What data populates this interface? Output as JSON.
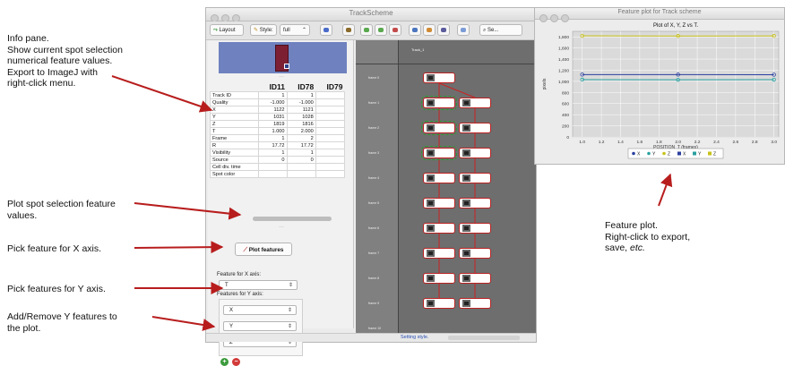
{
  "annotations": {
    "info": [
      "Info pane.",
      "Show current spot selection",
      "numerical feature values.",
      "Export to ImageJ with",
      "right-click menu."
    ],
    "plot": [
      "Plot spot selection feature",
      "values."
    ],
    "xaxis": [
      "Pick feature for X axis."
    ],
    "yaxis": [
      "Pick features for Y axis."
    ],
    "addremove": [
      "Add/Remove Y features to",
      "the plot."
    ],
    "featureplot": [
      "Feature plot.",
      "Right-click to export,",
      "save, "
    ],
    "featureplot_etc": "etc."
  },
  "trackscheme": {
    "title": "TrackScheme",
    "toolbar": {
      "layout": "Layout",
      "style_label": "Style:",
      "style_value": "full",
      "search_placeholder": "Se..."
    },
    "table": {
      "columns": [
        "ID11",
        "ID78",
        "ID79"
      ],
      "rows": [
        {
          "name": "Track ID",
          "a": "1",
          "b": "1"
        },
        {
          "name": "Quality",
          "a": "-1.000",
          "b": "-1.000"
        },
        {
          "name": "X",
          "a": "1122",
          "b": "1121"
        },
        {
          "name": "Y",
          "a": "1031",
          "b": "1028"
        },
        {
          "name": "Z",
          "a": "1819",
          "b": "1816"
        },
        {
          "name": "T",
          "a": "1.000",
          "b": "2.000"
        },
        {
          "name": "Frame",
          "a": "1",
          "b": "2"
        },
        {
          "name": "R",
          "a": "17.72",
          "b": "17.72"
        },
        {
          "name": "Visibility",
          "a": "1",
          "b": "1"
        },
        {
          "name": "Source",
          "a": "0",
          "b": "0"
        },
        {
          "name": "Cell div. time",
          "a": "",
          "b": ""
        },
        {
          "name": "Spot color",
          "a": "",
          "b": ""
        }
      ]
    },
    "plot_button": "Plot features",
    "x_label": "Feature for X axis:",
    "x_value": "T",
    "y_label": "Features for Y axis:",
    "y_values": [
      "X",
      "Y",
      "Z"
    ],
    "track_label": "Track_1",
    "frames": [
      "frame 0",
      "frame 1",
      "frame 2",
      "frame 3",
      "frame 4",
      "frame 5",
      "frame 6",
      "frame 7",
      "frame 8",
      "frame 9",
      "frame 10"
    ],
    "status": "Setting style."
  },
  "featureplot": {
    "title": "Feature plot for Track scheme",
    "chart_data": {
      "type": "line",
      "title": "Plot of X, Y, Z vs T.",
      "xlabel": "POSITION_T (frames)",
      "ylabel": "pixels",
      "xlim": [
        0.9,
        3.05
      ],
      "ylim": [
        0,
        1900
      ],
      "xticks": [
        "1.0",
        "1.2",
        "1.4",
        "1.6",
        "1.8",
        "2.0",
        "2.2",
        "2.4",
        "2.6",
        "2.8",
        "3.0"
      ],
      "yticks": [
        "0",
        "200",
        "400",
        "600",
        "800",
        "1,000",
        "1,200",
        "1,400",
        "1,600",
        "1,800"
      ],
      "x": [
        1.0,
        2.0,
        3.0
      ],
      "series": [
        {
          "name": "X",
          "values": [
            1122,
            1121,
            1120
          ],
          "color": "#2b3f9e"
        },
        {
          "name": "Y",
          "values": [
            1031,
            1028,
            1030
          ],
          "color": "#2aa0a0"
        },
        {
          "name": "Z",
          "values": [
            1819,
            1816,
            1818
          ],
          "color": "#c8c21a"
        }
      ],
      "legend": "bottom",
      "grid": true
    }
  }
}
